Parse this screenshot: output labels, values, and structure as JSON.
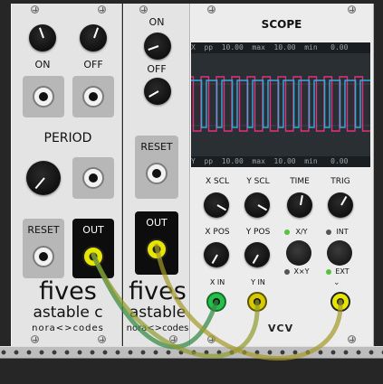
{
  "fives_c": {
    "on_label": "ON",
    "off_label": "OFF",
    "period_label": "PERIOD",
    "reset_label": "RESET",
    "out_label": "OUT",
    "brand_big": "fives",
    "brand_sub": "astable c",
    "maker": "nora<>codes"
  },
  "fives": {
    "on_label": "ON",
    "off_label": "OFF",
    "reset_label": "RESET",
    "out_label": "OUT",
    "brand_big": "fives",
    "brand_sub": "astable",
    "maker": "nora<>codes"
  },
  "scope": {
    "title": "SCOPE",
    "top_bar": "X  pp  10.00  max  10.00  min   0.00",
    "bottom_bar": "Y  pp  10.00  max  10.00  min   0.00",
    "x_scl": "X SCL",
    "y_scl": "Y SCL",
    "time": "TIME",
    "trig": "TRIG",
    "x_pos": "X POS",
    "y_pos": "Y POS",
    "xy_label": "X/Y",
    "xxy_label": "X×Y",
    "int_label": "INT",
    "ext_label": "EXT",
    "x_in": "X IN",
    "y_in": "Y IN",
    "logo": "VCV",
    "colors": {
      "trace_x": "#36a9e1",
      "trace_y": "#e2307e"
    }
  }
}
